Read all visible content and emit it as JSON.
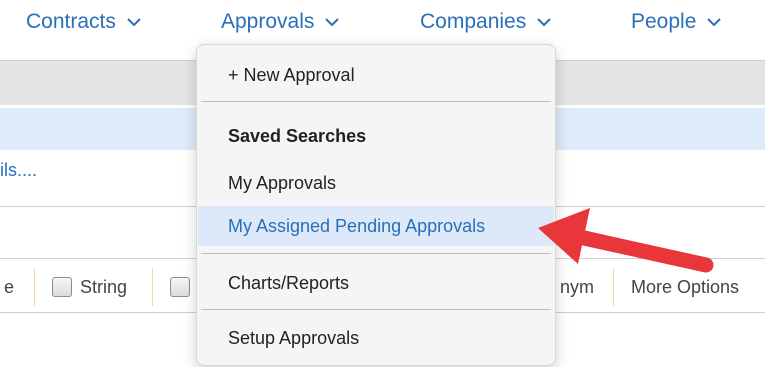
{
  "nav": {
    "items": [
      {
        "label": "Contracts"
      },
      {
        "label": "Approvals"
      },
      {
        "label": "Companies"
      },
      {
        "label": "People"
      }
    ]
  },
  "page": {
    "details_link": "ils....",
    "options_row": {
      "left_fragment": "e",
      "string_label": "String",
      "nym_fragment": "nym",
      "more_options": "More Options"
    }
  },
  "dropdown": {
    "new_approval": "+ New Approval",
    "saved_searches_heading": "Saved Searches",
    "my_approvals": "My Approvals",
    "my_assigned_pending": "My Assigned Pending Approvals",
    "charts_reports": "Charts/Reports",
    "setup_approvals": "Setup Approvals"
  },
  "colors": {
    "link_blue": "#2a6fb8",
    "highlight": "#dde9f8",
    "arrow_red": "#e8363a"
  },
  "icons": [
    "chevron-down-icon",
    "checkbox-icon",
    "annotation-arrow"
  ]
}
